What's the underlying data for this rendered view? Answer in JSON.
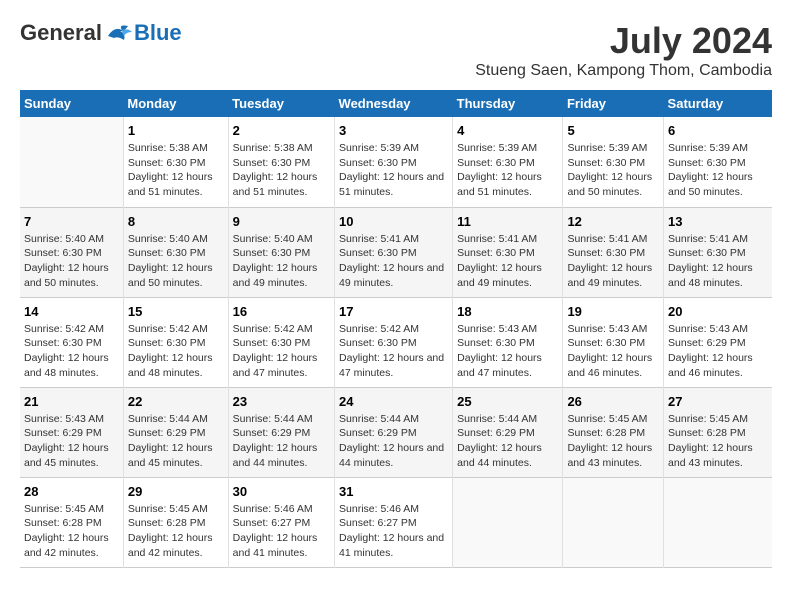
{
  "header": {
    "logo_general": "General",
    "logo_blue": "Blue",
    "month_year": "July 2024",
    "location": "Stueng Saen, Kampong Thom, Cambodia"
  },
  "days_of_week": [
    "Sunday",
    "Monday",
    "Tuesday",
    "Wednesday",
    "Thursday",
    "Friday",
    "Saturday"
  ],
  "weeks": [
    {
      "cells": [
        {
          "day": "",
          "sunrise": "",
          "sunset": "",
          "daylight": "",
          "empty": true
        },
        {
          "day": "1",
          "sunrise": "Sunrise: 5:38 AM",
          "sunset": "Sunset: 6:30 PM",
          "daylight": "Daylight: 12 hours and 51 minutes."
        },
        {
          "day": "2",
          "sunrise": "Sunrise: 5:38 AM",
          "sunset": "Sunset: 6:30 PM",
          "daylight": "Daylight: 12 hours and 51 minutes."
        },
        {
          "day": "3",
          "sunrise": "Sunrise: 5:39 AM",
          "sunset": "Sunset: 6:30 PM",
          "daylight": "Daylight: 12 hours and 51 minutes."
        },
        {
          "day": "4",
          "sunrise": "Sunrise: 5:39 AM",
          "sunset": "Sunset: 6:30 PM",
          "daylight": "Daylight: 12 hours and 51 minutes."
        },
        {
          "day": "5",
          "sunrise": "Sunrise: 5:39 AM",
          "sunset": "Sunset: 6:30 PM",
          "daylight": "Daylight: 12 hours and 50 minutes."
        },
        {
          "day": "6",
          "sunrise": "Sunrise: 5:39 AM",
          "sunset": "Sunset: 6:30 PM",
          "daylight": "Daylight: 12 hours and 50 minutes."
        }
      ]
    },
    {
      "cells": [
        {
          "day": "7",
          "sunrise": "Sunrise: 5:40 AM",
          "sunset": "Sunset: 6:30 PM",
          "daylight": "Daylight: 12 hours and 50 minutes."
        },
        {
          "day": "8",
          "sunrise": "Sunrise: 5:40 AM",
          "sunset": "Sunset: 6:30 PM",
          "daylight": "Daylight: 12 hours and 50 minutes."
        },
        {
          "day": "9",
          "sunrise": "Sunrise: 5:40 AM",
          "sunset": "Sunset: 6:30 PM",
          "daylight": "Daylight: 12 hours and 49 minutes."
        },
        {
          "day": "10",
          "sunrise": "Sunrise: 5:41 AM",
          "sunset": "Sunset: 6:30 PM",
          "daylight": "Daylight: 12 hours and 49 minutes."
        },
        {
          "day": "11",
          "sunrise": "Sunrise: 5:41 AM",
          "sunset": "Sunset: 6:30 PM",
          "daylight": "Daylight: 12 hours and 49 minutes."
        },
        {
          "day": "12",
          "sunrise": "Sunrise: 5:41 AM",
          "sunset": "Sunset: 6:30 PM",
          "daylight": "Daylight: 12 hours and 49 minutes."
        },
        {
          "day": "13",
          "sunrise": "Sunrise: 5:41 AM",
          "sunset": "Sunset: 6:30 PM",
          "daylight": "Daylight: 12 hours and 48 minutes."
        }
      ]
    },
    {
      "cells": [
        {
          "day": "14",
          "sunrise": "Sunrise: 5:42 AM",
          "sunset": "Sunset: 6:30 PM",
          "daylight": "Daylight: 12 hours and 48 minutes."
        },
        {
          "day": "15",
          "sunrise": "Sunrise: 5:42 AM",
          "sunset": "Sunset: 6:30 PM",
          "daylight": "Daylight: 12 hours and 48 minutes."
        },
        {
          "day": "16",
          "sunrise": "Sunrise: 5:42 AM",
          "sunset": "Sunset: 6:30 PM",
          "daylight": "Daylight: 12 hours and 47 minutes."
        },
        {
          "day": "17",
          "sunrise": "Sunrise: 5:42 AM",
          "sunset": "Sunset: 6:30 PM",
          "daylight": "Daylight: 12 hours and 47 minutes."
        },
        {
          "day": "18",
          "sunrise": "Sunrise: 5:43 AM",
          "sunset": "Sunset: 6:30 PM",
          "daylight": "Daylight: 12 hours and 47 minutes."
        },
        {
          "day": "19",
          "sunrise": "Sunrise: 5:43 AM",
          "sunset": "Sunset: 6:30 PM",
          "daylight": "Daylight: 12 hours and 46 minutes."
        },
        {
          "day": "20",
          "sunrise": "Sunrise: 5:43 AM",
          "sunset": "Sunset: 6:29 PM",
          "daylight": "Daylight: 12 hours and 46 minutes."
        }
      ]
    },
    {
      "cells": [
        {
          "day": "21",
          "sunrise": "Sunrise: 5:43 AM",
          "sunset": "Sunset: 6:29 PM",
          "daylight": "Daylight: 12 hours and 45 minutes."
        },
        {
          "day": "22",
          "sunrise": "Sunrise: 5:44 AM",
          "sunset": "Sunset: 6:29 PM",
          "daylight": "Daylight: 12 hours and 45 minutes."
        },
        {
          "day": "23",
          "sunrise": "Sunrise: 5:44 AM",
          "sunset": "Sunset: 6:29 PM",
          "daylight": "Daylight: 12 hours and 44 minutes."
        },
        {
          "day": "24",
          "sunrise": "Sunrise: 5:44 AM",
          "sunset": "Sunset: 6:29 PM",
          "daylight": "Daylight: 12 hours and 44 minutes."
        },
        {
          "day": "25",
          "sunrise": "Sunrise: 5:44 AM",
          "sunset": "Sunset: 6:29 PM",
          "daylight": "Daylight: 12 hours and 44 minutes."
        },
        {
          "day": "26",
          "sunrise": "Sunrise: 5:45 AM",
          "sunset": "Sunset: 6:28 PM",
          "daylight": "Daylight: 12 hours and 43 minutes."
        },
        {
          "day": "27",
          "sunrise": "Sunrise: 5:45 AM",
          "sunset": "Sunset: 6:28 PM",
          "daylight": "Daylight: 12 hours and 43 minutes."
        }
      ]
    },
    {
      "cells": [
        {
          "day": "28",
          "sunrise": "Sunrise: 5:45 AM",
          "sunset": "Sunset: 6:28 PM",
          "daylight": "Daylight: 12 hours and 42 minutes."
        },
        {
          "day": "29",
          "sunrise": "Sunrise: 5:45 AM",
          "sunset": "Sunset: 6:28 PM",
          "daylight": "Daylight: 12 hours and 42 minutes."
        },
        {
          "day": "30",
          "sunrise": "Sunrise: 5:46 AM",
          "sunset": "Sunset: 6:27 PM",
          "daylight": "Daylight: 12 hours and 41 minutes."
        },
        {
          "day": "31",
          "sunrise": "Sunrise: 5:46 AM",
          "sunset": "Sunset: 6:27 PM",
          "daylight": "Daylight: 12 hours and 41 minutes."
        },
        {
          "day": "",
          "sunrise": "",
          "sunset": "",
          "daylight": "",
          "empty": true
        },
        {
          "day": "",
          "sunrise": "",
          "sunset": "",
          "daylight": "",
          "empty": true
        },
        {
          "day": "",
          "sunrise": "",
          "sunset": "",
          "daylight": "",
          "empty": true
        }
      ]
    }
  ]
}
